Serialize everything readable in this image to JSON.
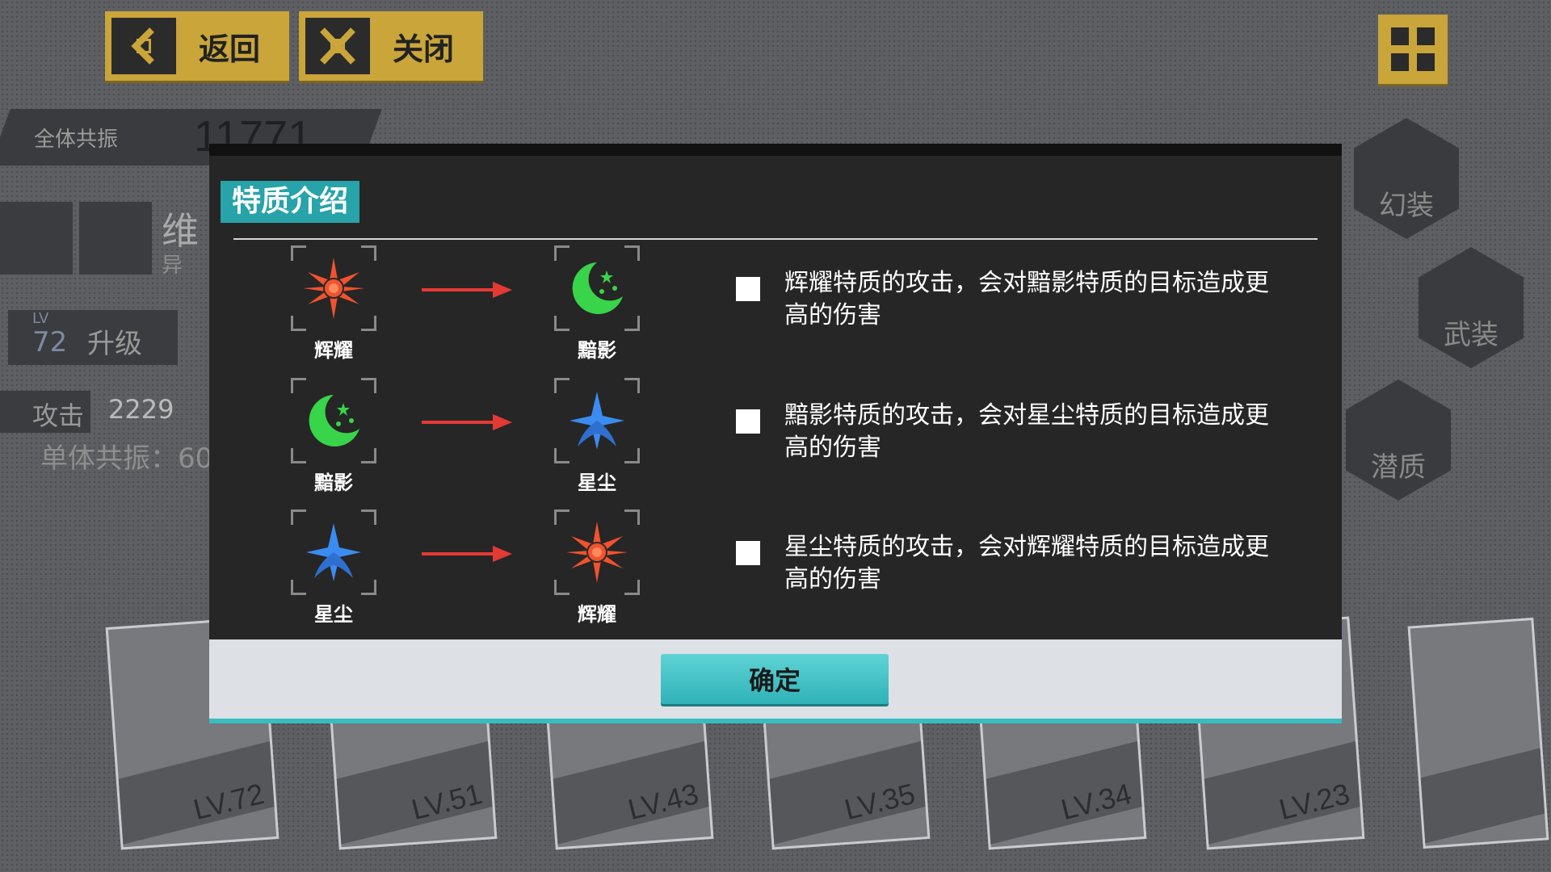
{
  "header": {
    "back_label": "返回",
    "close_label": "关闭"
  },
  "background": {
    "resonance_label": "全体共振",
    "resonance_value": "11771",
    "char_name_partial": "维",
    "char_sub_partial": "异",
    "level_prefix": "LV",
    "level_value": "72",
    "upgrade_label": "升级",
    "attack_label": "攻击",
    "attack_value": "2229",
    "single_resonance": "单体共振：60",
    "side_menu": [
      "幻装",
      "武装",
      "潜质"
    ],
    "cards": [
      "LV.72",
      "LV.51",
      "LV.43",
      "LV.35",
      "LV.34",
      "LV.23"
    ]
  },
  "dialog": {
    "title": "特质介绍",
    "rows": [
      {
        "from": "辉耀",
        "to": "黯影",
        "desc": "辉耀特质的攻击，会对黯影特质的目标造成更高的伤害"
      },
      {
        "from": "黯影",
        "to": "星尘",
        "desc": "黯影特质的攻击，会对星尘特质的目标造成更高的伤害"
      },
      {
        "from": "星尘",
        "to": "辉耀",
        "desc": "星尘特质的攻击，会对辉耀特质的目标造成更高的伤害"
      }
    ],
    "confirm_label": "确定"
  },
  "colors": {
    "accent_teal": "#27a3a9",
    "button_gold": "#c9a53a",
    "radiance_red": "#f2522e",
    "shadow_green": "#38d44a",
    "stardust_blue": "#3b8cf0",
    "arrow_red": "#e53935"
  }
}
